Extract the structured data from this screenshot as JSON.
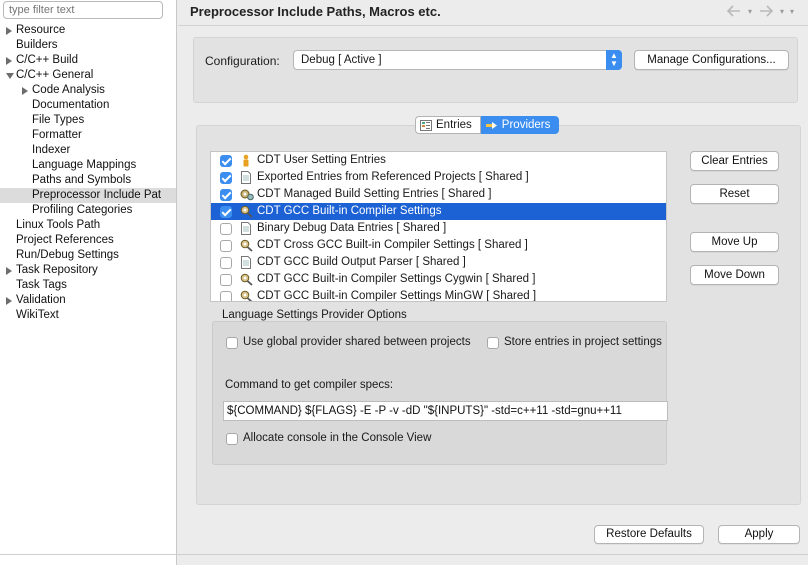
{
  "sidebar": {
    "filter_placeholder": "type filter text",
    "items": [
      {
        "label": "Resource",
        "level": 0,
        "twisty": "collapsed",
        "selected": false
      },
      {
        "label": "Builders",
        "level": 0,
        "twisty": "none",
        "selected": false
      },
      {
        "label": "C/C++ Build",
        "level": 0,
        "twisty": "collapsed",
        "selected": false
      },
      {
        "label": "C/C++ General",
        "level": 0,
        "twisty": "expanded",
        "selected": false
      },
      {
        "label": "Code Analysis",
        "level": 1,
        "twisty": "collapsed",
        "selected": false
      },
      {
        "label": "Documentation",
        "level": 1,
        "twisty": "none",
        "selected": false
      },
      {
        "label": "File Types",
        "level": 1,
        "twisty": "none",
        "selected": false
      },
      {
        "label": "Formatter",
        "level": 1,
        "twisty": "none",
        "selected": false
      },
      {
        "label": "Indexer",
        "level": 1,
        "twisty": "none",
        "selected": false
      },
      {
        "label": "Language Mappings",
        "level": 1,
        "twisty": "none",
        "selected": false
      },
      {
        "label": "Paths and Symbols",
        "level": 1,
        "twisty": "none",
        "selected": false
      },
      {
        "label": "Preprocessor Include Pat",
        "level": 1,
        "twisty": "none",
        "selected": true
      },
      {
        "label": "Profiling Categories",
        "level": 1,
        "twisty": "none",
        "selected": false
      },
      {
        "label": "Linux Tools Path",
        "level": 0,
        "twisty": "none",
        "selected": false
      },
      {
        "label": "Project References",
        "level": 0,
        "twisty": "none",
        "selected": false
      },
      {
        "label": "Run/Debug Settings",
        "level": 0,
        "twisty": "none",
        "selected": false
      },
      {
        "label": "Task Repository",
        "level": 0,
        "twisty": "collapsed",
        "selected": false
      },
      {
        "label": "Task Tags",
        "level": 0,
        "twisty": "none",
        "selected": false
      },
      {
        "label": "Validation",
        "level": 0,
        "twisty": "collapsed",
        "selected": false
      },
      {
        "label": "WikiText",
        "level": 0,
        "twisty": "none",
        "selected": false
      }
    ]
  },
  "header": {
    "title": "Preprocessor Include Paths, Macros etc.",
    "nav_icons": [
      "back-arrow-icon",
      "dropdown-icon",
      "forward-arrow-icon",
      "dropdown-icon",
      "view-menu-icon"
    ]
  },
  "configuration": {
    "label": "Configuration:",
    "value": "Debug  [ Active ]",
    "manage_button": "Manage Configurations..."
  },
  "tabs": [
    {
      "label": "Entries",
      "icon": "entries-icon",
      "active": false
    },
    {
      "label": "Providers",
      "icon": "providers-icon",
      "active": true
    }
  ],
  "providers": [
    {
      "label": "CDT User Setting Entries",
      "checked": true,
      "selected": false,
      "icon": "user-icon"
    },
    {
      "label": "Exported Entries from Referenced Projects   [ Shared ]",
      "checked": true,
      "selected": false,
      "icon": "document-icon"
    },
    {
      "label": "CDT Managed Build Setting Entries   [ Shared ]",
      "checked": true,
      "selected": false,
      "icon": "build-gear-icon"
    },
    {
      "label": "CDT GCC Built-in Compiler Settings",
      "checked": true,
      "selected": true,
      "icon": "compiler-settings-icon"
    },
    {
      "label": "Binary Debug Data Entries   [ Shared ]",
      "checked": false,
      "selected": false,
      "icon": "document-icon"
    },
    {
      "label": "CDT Cross GCC Built-in Compiler Settings   [ Shared ]",
      "checked": false,
      "selected": false,
      "icon": "compiler-settings-icon"
    },
    {
      "label": "CDT GCC Build Output Parser   [ Shared ]",
      "checked": false,
      "selected": false,
      "icon": "document-icon"
    },
    {
      "label": "CDT GCC Built-in Compiler Settings Cygwin   [ Shared ]",
      "checked": false,
      "selected": false,
      "icon": "compiler-settings-icon"
    },
    {
      "label": "CDT GCC Built-in Compiler Settings MinGW   [ Shared ]",
      "checked": false,
      "selected": false,
      "icon": "compiler-settings-icon"
    }
  ],
  "side_buttons": {
    "clear": "Clear Entries",
    "reset": "Reset",
    "move_up": "Move Up",
    "move_down": "Move Down"
  },
  "options": {
    "group_label": "Language Settings Provider Options",
    "use_global": {
      "label": "Use global provider shared between projects",
      "checked": false
    },
    "store_entries": {
      "label": "Store entries in project settings",
      "checked": false
    },
    "command_label": "Command to get compiler specs:",
    "command_value": "${COMMAND} ${FLAGS} -E -P -v -dD \"${INPUTS}\" -std=c++11 -std=gnu++11",
    "allocate_console": {
      "label": "Allocate console in the Console View",
      "checked": false
    }
  },
  "footer": {
    "restore_defaults": "Restore Defaults",
    "apply": "Apply"
  },
  "colors": {
    "accent": "#3b8ef0",
    "selection": "#1d62d5"
  }
}
